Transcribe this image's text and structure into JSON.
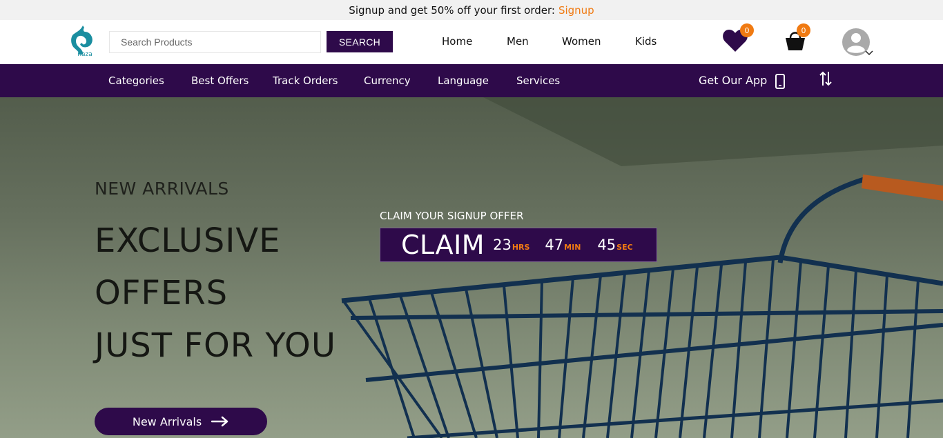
{
  "promo": {
    "text": "Signup and get 50% off your first order:",
    "link_label": "Signup"
  },
  "brand": {
    "logo_text": "naza",
    "color": "#1a8ea0"
  },
  "search": {
    "placeholder": "Search Products",
    "button_label": "SEARCH"
  },
  "main_nav": {
    "items": [
      {
        "label": "Home"
      },
      {
        "label": "Men"
      },
      {
        "label": "Women"
      },
      {
        "label": "Kids"
      }
    ]
  },
  "header_icons": {
    "wishlist": {
      "icon": "heart-icon",
      "count": "0"
    },
    "cart": {
      "icon": "shopping-basket-icon",
      "count": "0"
    },
    "account": {
      "icon": "user-avatar-icon",
      "dropdown_icon": "chevron-down-icon"
    }
  },
  "sub_nav": {
    "items": [
      {
        "label": "Categories"
      },
      {
        "label": "Best Offers"
      },
      {
        "label": "Track Orders"
      },
      {
        "label": "Currency"
      },
      {
        "label": "Language"
      },
      {
        "label": "Services"
      }
    ],
    "app_label": "Get Our App",
    "app_icon": "mobile-phone-icon",
    "sort_icon": "sort-arrows-icon"
  },
  "hero": {
    "eyebrow": "NEW ARRIVALS",
    "headline_lines": [
      "EXCLUSIVE",
      "OFFERS",
      "JUST FOR YOU"
    ],
    "cta_label": "New Arrivals",
    "cta_icon": "arrow-right-icon"
  },
  "offer": {
    "title": "CLAIM YOUR SIGNUP OFFER",
    "claim_label": "CLAIM",
    "timer": [
      {
        "value": "23",
        "unit": "HRS"
      },
      {
        "value": "47",
        "unit": "MIN"
      },
      {
        "value": "45",
        "unit": "SEC"
      }
    ]
  },
  "colors": {
    "primary": "#2e0a4a",
    "accent": "#f07a12",
    "promo_bg": "#f1f1f1"
  }
}
